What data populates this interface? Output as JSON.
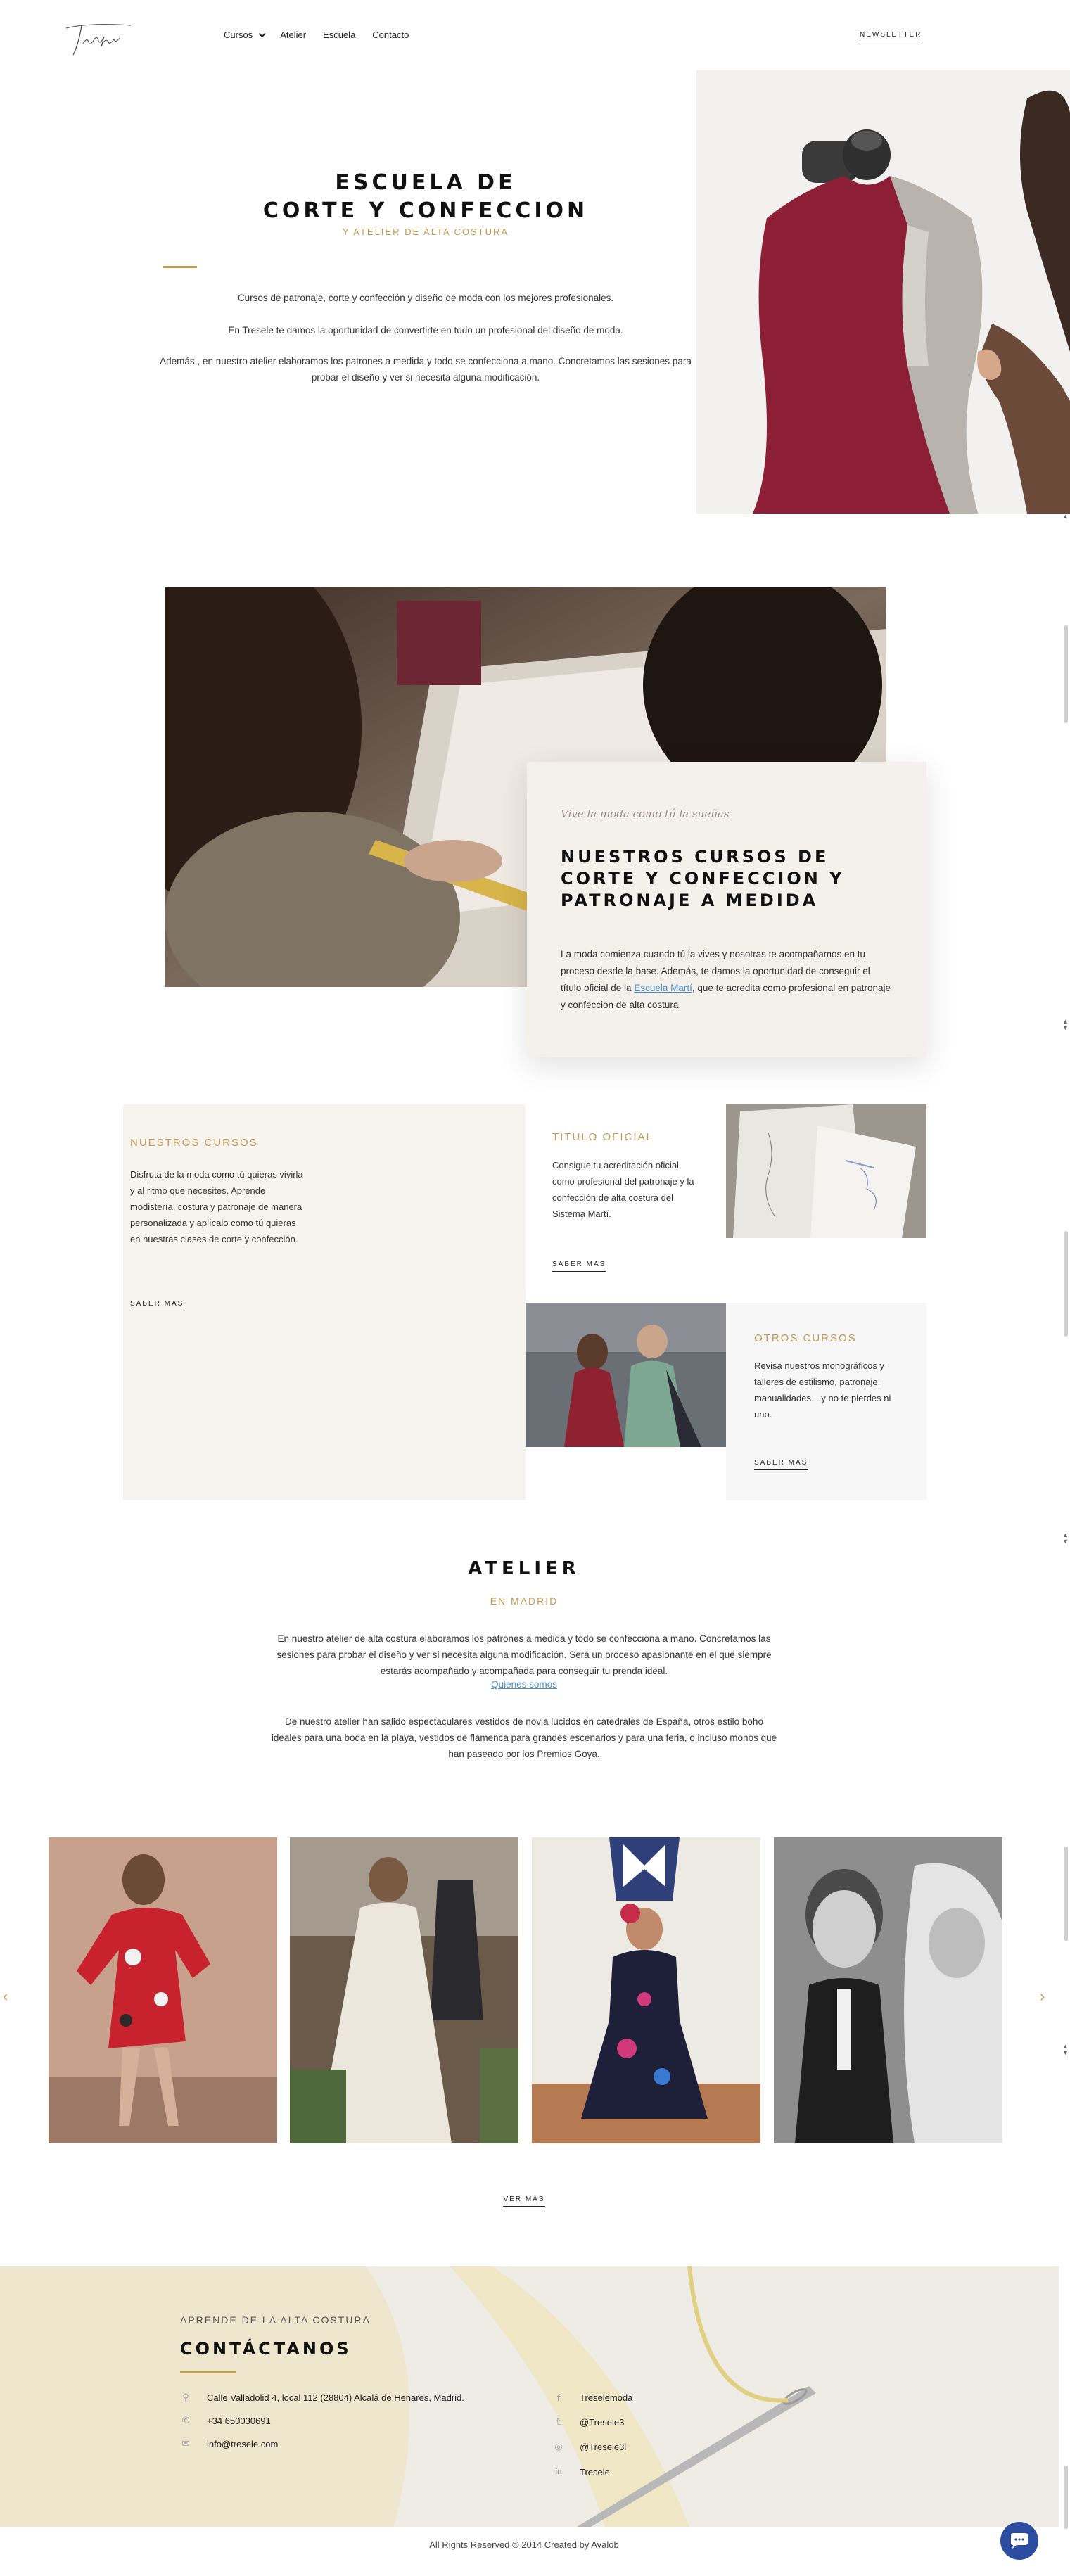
{
  "brand": {
    "logo_text": "Tresele"
  },
  "nav": {
    "items": [
      "Cursos",
      "Atelier",
      "Escuela",
      "Contacto"
    ],
    "newsletter": "NEWSLETTER"
  },
  "hero": {
    "title_line1": "ESCUELA DE",
    "title_line2": "CORTE Y CONFECCION",
    "subtitle": "Y ATELIER DE ALTA COSTURA",
    "p1": "Cursos de patronaje, corte y confección y diseño de moda con los mejores profesionales.",
    "p2": "En Tresele te damos la oportunidad de convertirte en todo un profesional del diseño de moda.",
    "p3": "Además , en nuestro atelier elaboramos los patrones a medida y todo se confecciona a mano. Concretamos las sesiones para probar el diseño y ver si necesita alguna modificación."
  },
  "courses_intro": {
    "script": "Vive la moda como tú la sueñas",
    "title": "NUESTROS CURSOS DE CORTE Y CONFECCION Y PATRONAJE A MEDIDA",
    "p_before_link": "La moda comienza cuando tú la vives y nosotras te acompañamos en tu proceso desde la base. Además, te damos la oportunidad de conseguir el título oficial de la ",
    "link": "Escuela Martí",
    "p_after_link": ", que te acredita como profesional en patronaje y confección de alta costura."
  },
  "course_cards": [
    {
      "label": "NUESTROS CURSOS",
      "text": "Disfruta de la moda como tú quieras vivirla y al ritmo que necesites. Aprende modistería, costura y patronaje de manera personalizada y aplícalo como tú quieras en nuestras clases de corte y confección.",
      "more": "SABER MAS"
    },
    {
      "label": "TITULO OFICIAL",
      "text": "Consigue tu acreditación oficial como profesional del patronaje y la confección de alta costura del Sistema Martí.",
      "more": "SABER MAS"
    },
    {
      "label": "OTROS CURSOS",
      "text": "Revisa nuestros monográficos y talleres de estilismo, patronaje, manualidades... y no te pierdes ni uno.",
      "more": "SABER MAS"
    }
  ],
  "atelier": {
    "title": "ATELIER",
    "subtitle": "EN MADRID",
    "p1": "En nuestro atelier de alta costura elaboramos los patrones a medida y todo se confecciona a mano. Concretamos las sesiones para probar el diseño y ver si necesita alguna modificación. Será un proceso apasionante en  el que siempre estarás acompañado y acompañada para conseguir tu prenda ideal.",
    "link": "Quienes somos",
    "p2": "De nuestro atelier han salido espectaculares vestidos de novia lucidos en catedrales de España, otros estilo boho ideales para una boda en la playa, vestidos de flamenca para grandes escenarios y para una feria, o incluso monos que han paseado por los Premios Goya.",
    "more": "VER MAS"
  },
  "contact": {
    "kicker": "APRENDE DE LA ALTA COSTURA",
    "title": "CONTÁCTANOS",
    "address": "Calle Valladolid 4, local 112 (28804) Alcalá de Henares, Madrid.",
    "phone": "+34 650030691",
    "email": "info@tresele.com",
    "social": [
      {
        "icon": "facebook-icon",
        "label": "Treselemoda"
      },
      {
        "icon": "twitter-icon",
        "label": "@Tresele3"
      },
      {
        "icon": "instagram-icon",
        "label": "@Tresele3l"
      },
      {
        "icon": "linkedin-icon",
        "label": "Tresele"
      }
    ]
  },
  "footer": {
    "text": "All Rights Reserved © 2014 Created by Avalob"
  },
  "colors": {
    "accent": "#c39a52",
    "card_bg": "#f4f1ed",
    "chat": "#2d4ea0"
  }
}
